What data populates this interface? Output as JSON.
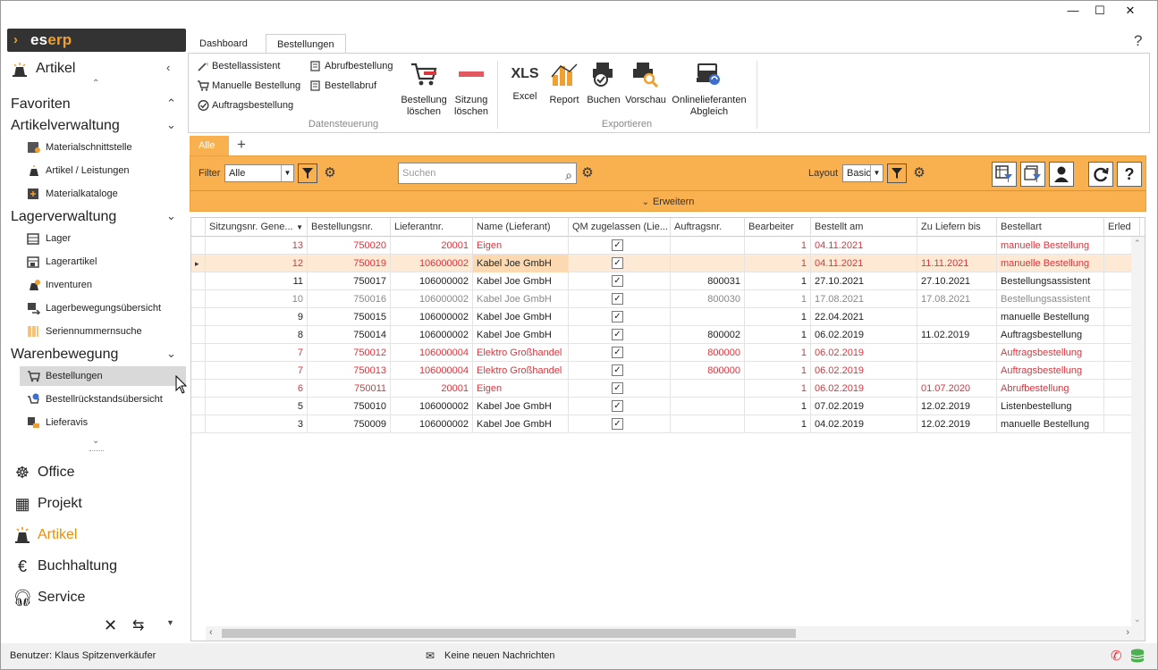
{
  "window": {
    "minimize": "—",
    "maximize": "☐",
    "close": "✕"
  },
  "logo": {
    "text_a": "es",
    "text_b": "erp"
  },
  "sidebar": {
    "module_title": "Artikel",
    "sections": [
      {
        "label": "Favoriten"
      },
      {
        "label": "Artikelverwaltung",
        "items": [
          "Materialschnittstelle",
          "Artikel / Leistungen",
          "Materialkataloge"
        ]
      },
      {
        "label": "Lagerverwaltung",
        "items": [
          "Lager",
          "Lagerartikel",
          "Inventuren",
          "Lagerbewegungsübersicht",
          "Seriennummernsuche"
        ]
      },
      {
        "label": "Warenbewegung",
        "items": [
          "Bestellungen",
          "Bestellrückstandsübersicht",
          "Lieferavis"
        ]
      }
    ],
    "modules": [
      "Office",
      "Projekt",
      "Artikel",
      "Buchhaltung",
      "Service"
    ]
  },
  "ribbon": {
    "tabs": [
      "Dashboard",
      "Bestellungen"
    ],
    "help": "?",
    "small": [
      "Bestellassistent",
      "Manuelle Bestellung",
      "Auftragsbestellung",
      "Abrufbestellung",
      "Bestellabruf"
    ],
    "big": [
      {
        "l1": "Bestellung",
        "l2": "löschen"
      },
      {
        "l1": "Sitzung",
        "l2": "löschen"
      },
      {
        "l1": "Excel",
        "l2": ""
      },
      {
        "l1": "Report",
        "l2": ""
      },
      {
        "l1": "Buchen",
        "l2": ""
      },
      {
        "l1": "Vorschau",
        "l2": ""
      },
      {
        "l1": "Onlinelieferanten",
        "l2": "Abgleich"
      }
    ],
    "xls": "XLS",
    "groups": [
      "Datensteuerung",
      "Exportieren"
    ]
  },
  "tabs": {
    "active": "Alle",
    "add": "+"
  },
  "filterbar": {
    "filter_label": "Filter",
    "filter_value": "Alle",
    "search_placeholder": "Suchen",
    "layout_label": "Layout",
    "layout_value": "Basic",
    "expand": "Erweitern"
  },
  "grid": {
    "columns": [
      "Sitzungsnr. Gene...",
      "Bestellungsnr.",
      "Lieferantnr.",
      "Name (Lieferant)",
      "QM zugelassen (Lie...",
      "Auftragsnr.",
      "Bearbeiter",
      "Bestellt am",
      "Zu Liefern bis",
      "Bestellart",
      "Erled"
    ],
    "rows": [
      {
        "s": "13",
        "b": "750020",
        "l": "20001",
        "n": "Eigen",
        "a": "",
        "e": "1",
        "d": "04.11.2021",
        "z": "",
        "art": "manuelle Bestellung",
        "style": "red"
      },
      {
        "s": "12",
        "b": "750019",
        "l": "106000002",
        "n": "Kabel Joe GmbH",
        "a": "",
        "e": "1",
        "d": "04.11.2021",
        "z": "11.11.2021",
        "art": "manuelle Bestellung",
        "style": "red sel"
      },
      {
        "s": "11",
        "b": "750017",
        "l": "106000002",
        "n": "Kabel Joe GmbH",
        "a": "800031",
        "e": "1",
        "d": "27.10.2021",
        "z": "27.10.2021",
        "art": "Bestellungsassistent",
        "style": ""
      },
      {
        "s": "10",
        "b": "750016",
        "l": "106000002",
        "n": "Kabel Joe GmbH",
        "a": "800030",
        "e": "1",
        "d": "17.08.2021",
        "z": "17.08.2021",
        "art": "Bestellungsassistent",
        "style": "gray"
      },
      {
        "s": "9",
        "b": "750015",
        "l": "106000002",
        "n": "Kabel Joe GmbH",
        "a": "",
        "e": "1",
        "d": "22.04.2021",
        "z": "",
        "art": "manuelle Bestellung",
        "style": ""
      },
      {
        "s": "8",
        "b": "750014",
        "l": "106000002",
        "n": "Kabel Joe GmbH",
        "a": "800002",
        "e": "1",
        "d": "06.02.2019",
        "z": "11.02.2019",
        "art": "Auftragsbestellung",
        "style": ""
      },
      {
        "s": "7",
        "b": "750012",
        "l": "106000004",
        "n": "Elektro Großhandel",
        "a": "800000",
        "e": "1",
        "d": "06.02.2019",
        "z": "",
        "art": "Auftragsbestellung",
        "style": "red"
      },
      {
        "s": "7",
        "b": "750013",
        "l": "106000004",
        "n": "Elektro Großhandel",
        "a": "800000",
        "e": "1",
        "d": "06.02.2019",
        "z": "",
        "art": "Auftragsbestellung",
        "style": "red"
      },
      {
        "s": "6",
        "b": "750011",
        "l": "20001",
        "n": "Eigen",
        "a": "",
        "e": "1",
        "d": "06.02.2019",
        "z": "01.07.2020",
        "art": "Abrufbestellung",
        "style": "red"
      },
      {
        "s": "5",
        "b": "750010",
        "l": "106000002",
        "n": "Kabel Joe GmbH",
        "a": "",
        "e": "1",
        "d": "07.02.2019",
        "z": "12.02.2019",
        "art": "Listenbestellung",
        "style": ""
      },
      {
        "s": "3",
        "b": "750009",
        "l": "106000002",
        "n": "Kabel Joe GmbH",
        "a": "",
        "e": "1",
        "d": "04.02.2019",
        "z": "12.02.2019",
        "art": "manuelle Bestellung",
        "style": ""
      }
    ]
  },
  "status": {
    "user": "Benutzer: Klaus Spitzenverkäufer",
    "messages": "Keine neuen Nachrichten"
  },
  "colors": {
    "accent": "#f9b04f",
    "red": "#d9363e",
    "selected_row": "#fde9d4"
  }
}
